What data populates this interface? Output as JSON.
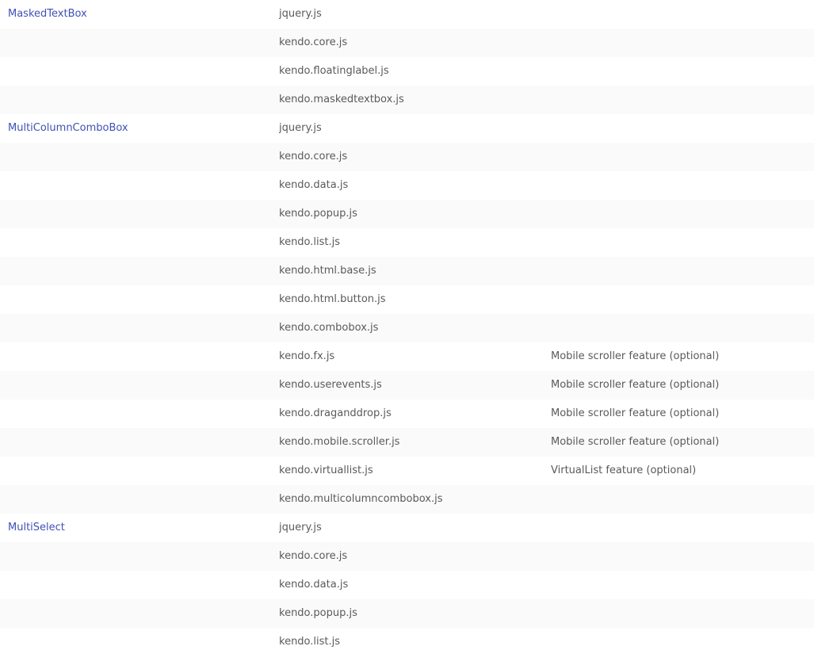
{
  "rows": [
    {
      "widget": "MaskedTextBox",
      "file": "jquery.js",
      "desc": ""
    },
    {
      "widget": "",
      "file": "kendo.core.js",
      "desc": ""
    },
    {
      "widget": "",
      "file": "kendo.floatinglabel.js",
      "desc": ""
    },
    {
      "widget": "",
      "file": "kendo.maskedtextbox.js",
      "desc": ""
    },
    {
      "widget": "MultiColumnComboBox",
      "file": "jquery.js",
      "desc": ""
    },
    {
      "widget": "",
      "file": "kendo.core.js",
      "desc": ""
    },
    {
      "widget": "",
      "file": "kendo.data.js",
      "desc": ""
    },
    {
      "widget": "",
      "file": "kendo.popup.js",
      "desc": ""
    },
    {
      "widget": "",
      "file": "kendo.list.js",
      "desc": ""
    },
    {
      "widget": "",
      "file": "kendo.html.base.js",
      "desc": ""
    },
    {
      "widget": "",
      "file": "kendo.html.button.js",
      "desc": ""
    },
    {
      "widget": "",
      "file": "kendo.combobox.js",
      "desc": ""
    },
    {
      "widget": "",
      "file": "kendo.fx.js",
      "desc": "Mobile scroller feature (optional)"
    },
    {
      "widget": "",
      "file": "kendo.userevents.js",
      "desc": "Mobile scroller feature (optional)"
    },
    {
      "widget": "",
      "file": "kendo.draganddrop.js",
      "desc": "Mobile scroller feature (optional)"
    },
    {
      "widget": "",
      "file": "kendo.mobile.scroller.js",
      "desc": "Mobile scroller feature (optional)"
    },
    {
      "widget": "",
      "file": "kendo.virtuallist.js",
      "desc": "VirtualList feature (optional)"
    },
    {
      "widget": "",
      "file": "kendo.multicolumncombobox.js",
      "desc": ""
    },
    {
      "widget": "MultiSelect",
      "file": "jquery.js",
      "desc": ""
    },
    {
      "widget": "",
      "file": "kendo.core.js",
      "desc": ""
    },
    {
      "widget": "",
      "file": "kendo.data.js",
      "desc": ""
    },
    {
      "widget": "",
      "file": "kendo.popup.js",
      "desc": ""
    },
    {
      "widget": "",
      "file": "kendo.list.js",
      "desc": ""
    }
  ],
  "colors": {
    "link": "#3f51b5",
    "text": "#5a5a5a",
    "stripe": "#fafafa"
  }
}
